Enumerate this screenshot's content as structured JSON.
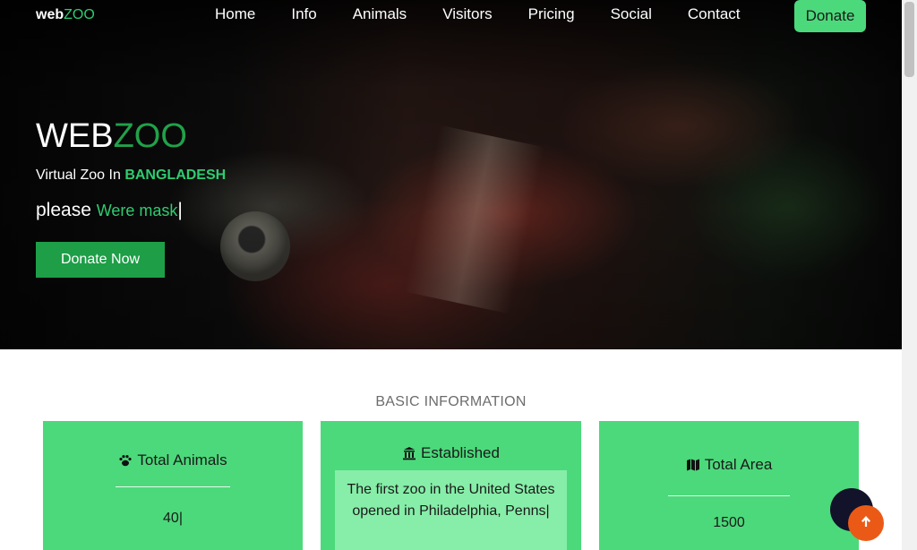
{
  "nav": {
    "logo_web": "web",
    "logo_zoo": "ZOO",
    "links": [
      "Home",
      "Info",
      "Animals",
      "Visitors",
      "Pricing",
      "Social",
      "Contact"
    ],
    "donate_label": "Donate"
  },
  "hero": {
    "title_main": "WEB",
    "title_accent": "ZOO",
    "subtitle_text": "Virtual Zoo In ",
    "subtitle_accent": "BANGLADESH",
    "typed_prefix": "please ",
    "typed_text": "Were mask",
    "typed_cursor": "|",
    "cta_label": "Donate Now"
  },
  "info": {
    "section_title": "BASIC INFORMATION",
    "cards": [
      {
        "icon": "paw-icon",
        "title": "Total Animals",
        "value": "40|"
      },
      {
        "icon": "building-icon",
        "title": "Established",
        "text": "The first zoo in the United States opened in Philadelphia, Penns|"
      },
      {
        "icon": "map-icon",
        "title": "Total Area",
        "value": "1500"
      }
    ]
  },
  "colors": {
    "accent_green": "#2ecc71",
    "card_green": "#4cd97b",
    "button_green": "#1e9e47",
    "top_button": "#ea5a16",
    "chat_button": "#12122a"
  }
}
